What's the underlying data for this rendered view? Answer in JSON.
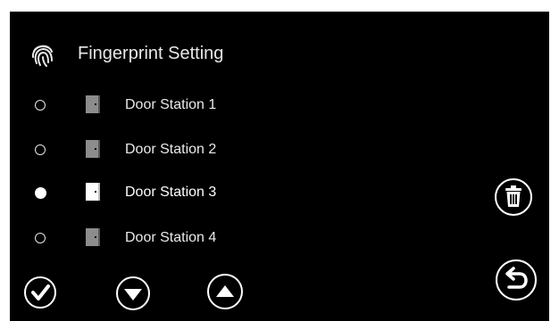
{
  "header": {
    "title": "Fingerprint Setting",
    "icon": "fingerprint-icon"
  },
  "stations": [
    {
      "label": "Door Station 1",
      "selected": false,
      "icon": "door-icon"
    },
    {
      "label": "Door Station 2",
      "selected": false,
      "icon": "door-icon"
    },
    {
      "label": "Door Station 3",
      "selected": true,
      "icon": "door-icon"
    },
    {
      "label": "Door Station 4",
      "selected": false,
      "icon": "door-icon"
    }
  ],
  "controls": {
    "confirm_icon": "check-icon",
    "down_icon": "arrow-down-icon",
    "up_icon": "arrow-up-icon",
    "delete_icon": "trash-icon",
    "back_icon": "return-icon"
  },
  "colors": {
    "background": "#000000",
    "foreground": "#ffffff",
    "door_inactive": "#8c8c8c",
    "door_active": "#ffffff"
  }
}
